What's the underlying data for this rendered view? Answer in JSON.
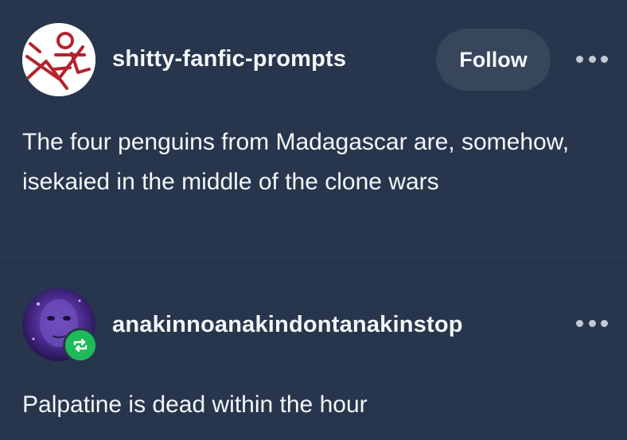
{
  "posts": [
    {
      "username": "shitty-fanfic-prompts",
      "follow_label": "Follow",
      "more_icon": "more-horizontal-icon",
      "avatar_icon": "sketch-avatar",
      "body": "The four penguins from Madagascar are, somehow, isekaied in the middle of the clone wars"
    },
    {
      "username": "anakinnoanakindontanakinstop",
      "more_icon": "more-horizontal-icon",
      "avatar_icon": "purple-portrait-avatar",
      "badge_icon": "reblog-icon",
      "body": "Palpatine is dead within the hour"
    }
  ],
  "colors": {
    "background": "#27364d",
    "follow_button": "#37465b",
    "reblog_badge": "#1fbb59",
    "text": "#f4f6f8"
  }
}
